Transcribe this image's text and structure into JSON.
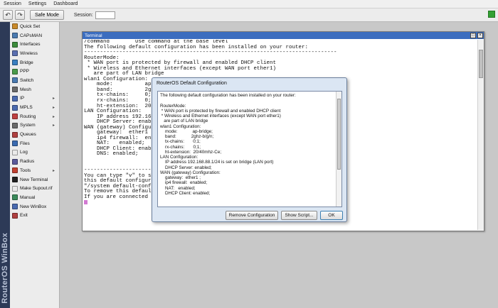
{
  "menu": [
    "Session",
    "Settings",
    "Dashboard"
  ],
  "toolbar": {
    "safe_mode_label": "Safe Mode",
    "session_label": "Session:",
    "session_value": ""
  },
  "brand": {
    "text": "RouterOS WinBox"
  },
  "sidebar": {
    "items": [
      {
        "label": "Quick Set",
        "icon": "quick-set-icon",
        "color": "#c98a2a",
        "submenu": false
      },
      {
        "label": "CAPsMAN",
        "icon": "capsman-icon",
        "color": "#4a7ab0",
        "submenu": false
      },
      {
        "label": "Interfaces",
        "icon": "interfaces-icon",
        "color": "#3c8c3c",
        "submenu": false
      },
      {
        "label": "Wireless",
        "icon": "wireless-icon",
        "color": "#5a6fb0",
        "submenu": false
      },
      {
        "label": "Bridge",
        "icon": "bridge-icon",
        "color": "#3a7fc0",
        "submenu": false
      },
      {
        "label": "PPP",
        "icon": "ppp-icon",
        "color": "#4a9a4a",
        "submenu": false
      },
      {
        "label": "Switch",
        "icon": "switch-icon",
        "color": "#4a7ab0",
        "submenu": false
      },
      {
        "label": "Mesh",
        "icon": "mesh-icon",
        "color": "#6a6a6a",
        "submenu": false
      },
      {
        "label": "IP",
        "icon": "ip-icon",
        "color": "#4a6ab0",
        "submenu": true
      },
      {
        "label": "MPLS",
        "icon": "mpls-icon",
        "color": "#4a6ab0",
        "submenu": true
      },
      {
        "label": "Routing",
        "icon": "routing-icon",
        "color": "#c04040",
        "submenu": true
      },
      {
        "label": "System",
        "icon": "system-icon",
        "color": "#6a6a6a",
        "submenu": true
      },
      {
        "label": "Queues",
        "icon": "queues-icon",
        "color": "#b04040",
        "submenu": false
      },
      {
        "label": "Files",
        "icon": "files-icon",
        "color": "#3a6ab0",
        "submenu": false
      },
      {
        "label": "Log",
        "icon": "log-icon",
        "color": "#eaeaea",
        "submenu": false
      },
      {
        "label": "Radius",
        "icon": "radius-icon",
        "color": "#5a5a9a",
        "submenu": false
      },
      {
        "label": "Tools",
        "icon": "tools-icon",
        "color": "#c04030",
        "submenu": true
      },
      {
        "label": "New Terminal",
        "icon": "terminal-icon",
        "color": "#222222",
        "submenu": false
      },
      {
        "label": "Make Supout.rif",
        "icon": "supout-icon",
        "color": "#eaeaea",
        "submenu": false
      },
      {
        "label": "Manual",
        "icon": "manual-icon",
        "color": "#3a8a5a",
        "submenu": false
      },
      {
        "label": "New WinBox",
        "icon": "winbox-icon",
        "color": "#4a6ab0",
        "submenu": false
      },
      {
        "label": "Exit",
        "icon": "exit-icon",
        "color": "#b04040",
        "submenu": false
      }
    ]
  },
  "terminal": {
    "title": "Terminal",
    "lines": [
      "/command        Use command at the base level",
      "The following default configuration has been installed on your router:",
      "-------------------------------------------------------------------------------",
      "RouterMode:",
      " * WAN port is protected by firewall and enabled DHCP client",
      " * Wireless and Ethernet interfaces (except WAN port ether1)",
      "   are part of LAN bridge",
      "wlan1 Configuration:",
      "    mode:          ap-bri",
      "    band:          2ghz-",
      "    tx-chains:     0;1;",
      "    rx-chains:     0;1;",
      "    ht-extension:  20/40",
      "LAN Configuration:",
      "    IP address 192.168.88",
      "    DHCP Server: enabled",
      "WAN (gateway) Configurat",
      "    gateway:  ether1 ;",
      "    ip4 firewall:  enabl",
      "    NAT:   enabled;",
      "    DHCP Client: enabled",
      "    DNS: enabled;",
      "",
      "",
      "-----------------------",
      "You can type \"v\" to see",
      "this default configurat",
      "\"/system default-configu",
      "To remove this default c",
      "If you are connected us"
    ]
  },
  "dialog": {
    "title": "RouterOS Default Configuration",
    "lines": [
      "The following default configuration has been installed on your router:",
      "",
      "RouterMode:",
      " * WAN port is protected by firewall and enabled DHCP client",
      " * Wireless and Ethernet interfaces (except WAN port ether1)",
      "   are part of LAN bridge",
      "wlan1 Configuration:",
      "    mode:            ap-bridge;",
      "    band:            2ghz-b/g/n;",
      "    tx-chains:       0;1;",
      "    rx-chains:       0;1;",
      "    ht-extension:  20/40mhz-Ce;",
      "LAN Configuration:",
      "    IP address 192.168.88.1/24 is set on bridge (LAN port)",
      "    DHCP Server: enabled;",
      "WAN (gateway) Configuration:",
      "    gateway:  ether1 ;",
      "    ip4 firewall:  enabled;",
      "    NAT:   enabled;",
      "    DHCP Client: enabled;"
    ],
    "buttons": {
      "remove": "Remove Configuration",
      "show_script": "Show Script...",
      "ok": "OK"
    }
  }
}
